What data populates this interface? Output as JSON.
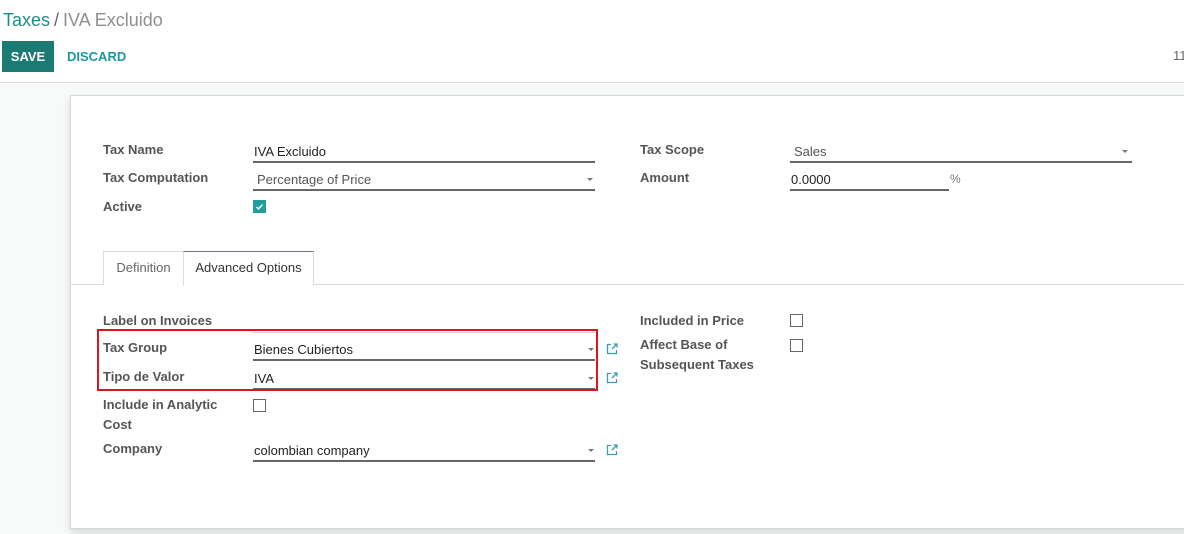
{
  "breadcrumb": {
    "parent": "Taxes",
    "separator": "/",
    "current": "IVA Excluido"
  },
  "toolbar": {
    "save_label": "SAVE",
    "discard_label": "DISCARD",
    "pager_text": "11"
  },
  "form": {
    "tax_name": {
      "label": "Tax Name",
      "value": "IVA Excluido"
    },
    "tax_computation": {
      "label": "Tax Computation",
      "value": "Percentage of Price"
    },
    "active": {
      "label": "Active",
      "checked": true
    },
    "tax_scope": {
      "label": "Tax Scope",
      "value": "Sales"
    },
    "amount": {
      "label": "Amount",
      "value": "0.0000",
      "unit": "%"
    }
  },
  "tabs": [
    {
      "label": "Definition",
      "active": false
    },
    {
      "label": "Advanced Options",
      "active": true
    }
  ],
  "advanced": {
    "label_on_invoices": {
      "label": "Label on Invoices",
      "value": ""
    },
    "tax_group": {
      "label": "Tax Group",
      "value": "Bienes Cubiertos"
    },
    "tipo_de_valor": {
      "label": "Tipo de Valor",
      "value": "IVA"
    },
    "include_in_analytic_cost": {
      "label_line1": "Include in Analytic",
      "label_line2": "Cost",
      "checked": false
    },
    "company": {
      "label": "Company",
      "value": "colombian company"
    },
    "included_in_price": {
      "label": "Included in Price",
      "checked": false
    },
    "affect_base": {
      "label_line1": "Affect Base of",
      "label_line2": "Subsequent Taxes",
      "checked": false
    }
  },
  "colors": {
    "accent": "#1c7a74",
    "link": "#1d97a0",
    "checkbox_checked": "#1f9e9b",
    "highlight_box": "#e0141e"
  }
}
